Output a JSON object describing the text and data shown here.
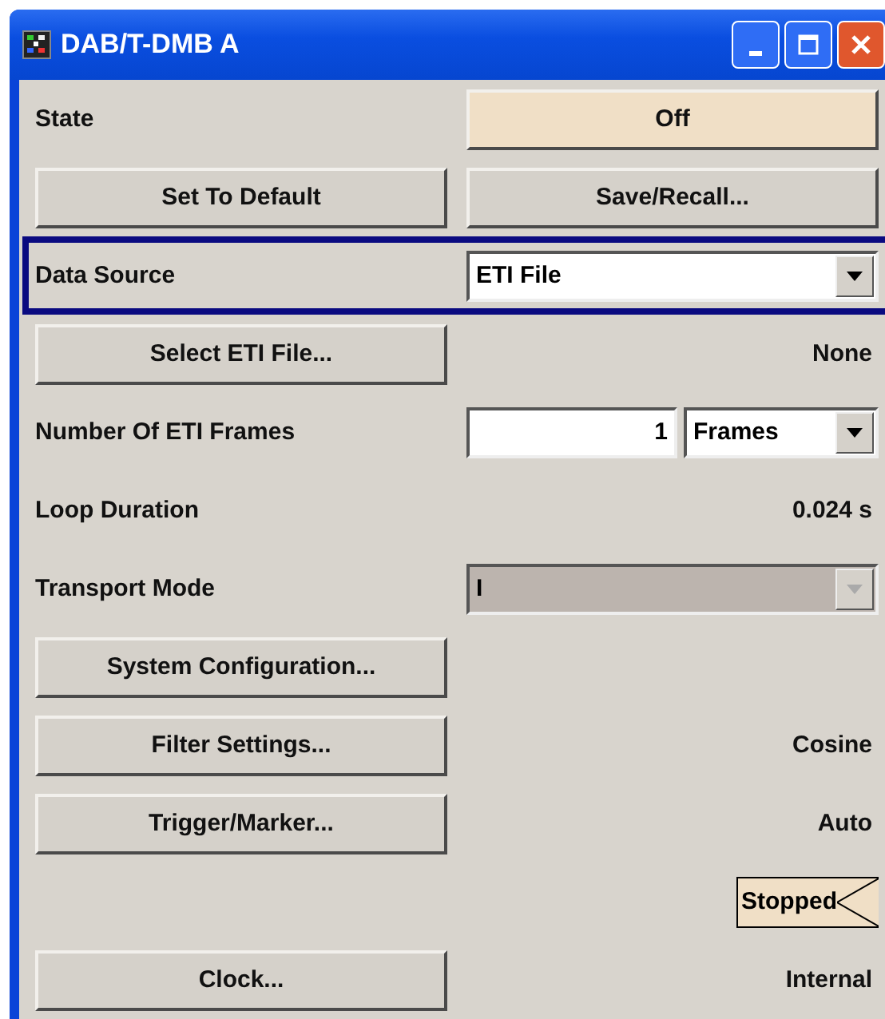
{
  "window": {
    "title": "DAB/T-DMB A"
  },
  "rows": [
    {
      "kind": "label-toggle",
      "label": "State",
      "value": "Off"
    },
    {
      "kind": "two-buttons",
      "buttons": [
        "Set To Default",
        "Save/Recall..."
      ]
    },
    {
      "kind": "label-select",
      "label": "Data Source",
      "value": "ETI File",
      "focused": true,
      "disabled": false
    },
    {
      "kind": "button-value",
      "button": "Select ETI File...",
      "value": "None"
    },
    {
      "kind": "label-number",
      "label": "Number Of ETI Frames",
      "value": "1",
      "unit": "Frames"
    },
    {
      "kind": "label-value",
      "label": "Loop Duration",
      "value": "0.024 s"
    },
    {
      "kind": "label-select",
      "label": "Transport Mode",
      "value": "I",
      "focused": false,
      "disabled": true
    },
    {
      "kind": "button-value",
      "button": "System Configuration..."
    },
    {
      "kind": "button-value",
      "button": "Filter Settings...",
      "value": "Cosine"
    },
    {
      "kind": "button-value",
      "button": "Trigger/Marker...",
      "value": "Auto"
    },
    {
      "kind": "status",
      "value": "Stopped"
    },
    {
      "kind": "button-value",
      "button": "Clock...",
      "value": "Internal"
    }
  ]
}
